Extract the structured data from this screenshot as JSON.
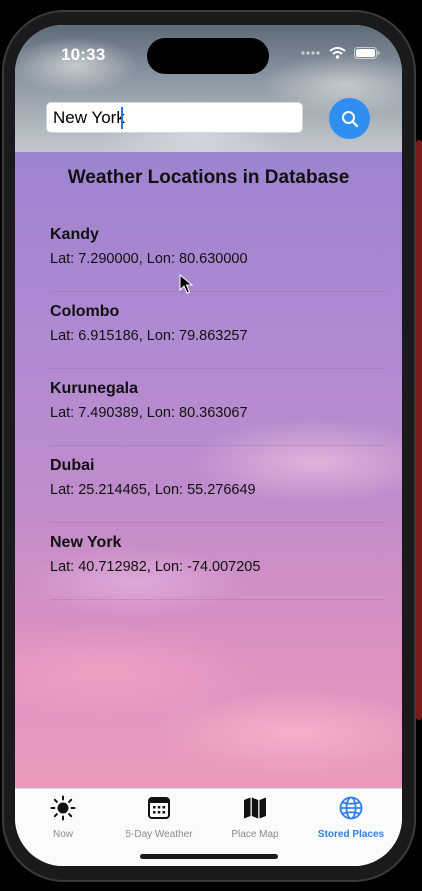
{
  "status_bar": {
    "time": "10:33"
  },
  "search": {
    "value": "New York"
  },
  "main": {
    "title": "Weather Locations in Database",
    "locations": [
      {
        "name": "Kandy",
        "coords": "Lat: 7.290000, Lon: 80.630000"
      },
      {
        "name": "Colombo",
        "coords": "Lat: 6.915186, Lon: 79.863257"
      },
      {
        "name": "Kurunegala",
        "coords": "Lat: 7.490389, Lon: 80.363067"
      },
      {
        "name": "Dubai",
        "coords": "Lat: 25.214465, Lon: 55.276649"
      },
      {
        "name": "New York",
        "coords": "Lat: 40.712982, Lon: -74.007205"
      }
    ]
  },
  "tabbar": {
    "tabs": [
      {
        "label": "Now",
        "icon": "sun-icon"
      },
      {
        "label": "5-Day Weather",
        "icon": "calendar-icon"
      },
      {
        "label": "Place Map",
        "icon": "map-icon"
      },
      {
        "label": "Stored Places",
        "icon": "globe-icon"
      }
    ],
    "active_index": 3
  },
  "colors": {
    "accent": "#2f7ee8",
    "search_button": "#2f8ef2"
  }
}
